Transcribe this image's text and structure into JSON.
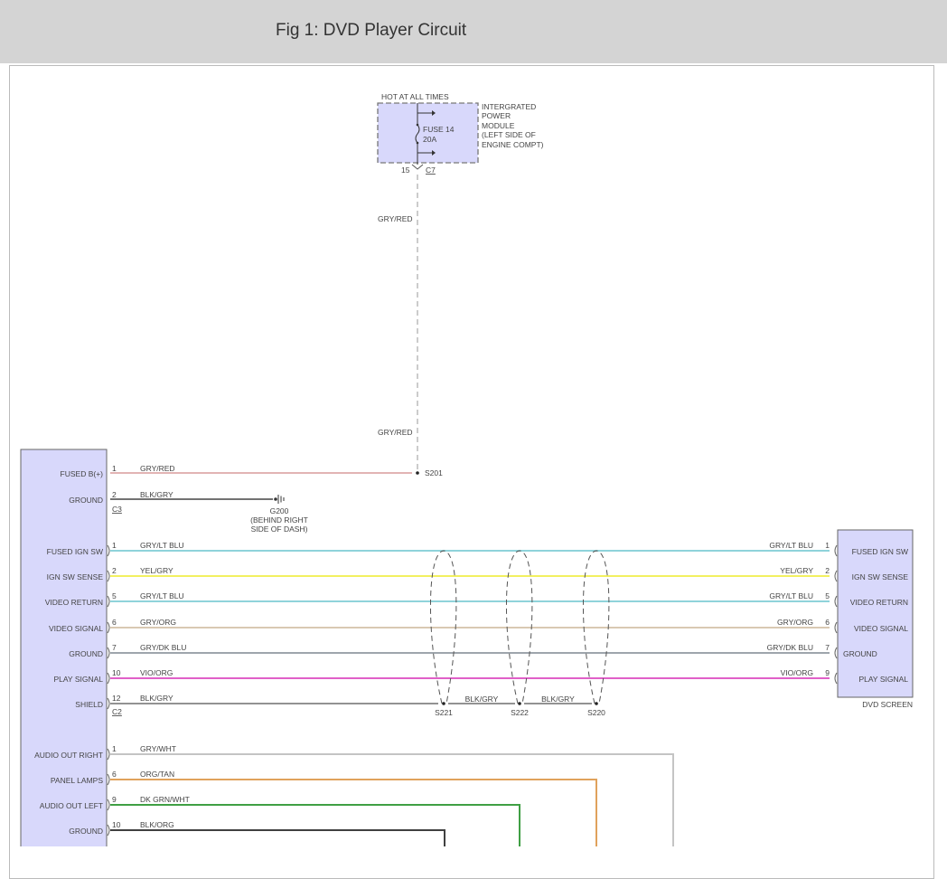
{
  "header": {
    "title": "Fig 1: DVD Player Circuit"
  },
  "power_module": {
    "hot_label": "HOT AT ALL TIMES",
    "name_lines": [
      "INTERGRATED",
      "POWER",
      "MODULE",
      "(LEFT SIDE OF",
      "ENGINE COMPT)"
    ],
    "fuse_name": "FUSE 14",
    "fuse_rating": "20A",
    "pin": "15",
    "connector": "C7"
  },
  "feed_wire": {
    "color_label_top": "GRY/RED",
    "color_label_bottom": "GRY/RED",
    "splice": "S201"
  },
  "ground": {
    "name": "G200",
    "location_lines": [
      "(BEHIND RIGHT",
      "SIDE OF DASH)"
    ]
  },
  "left_module": {
    "c3_connector": "C3",
    "c2_connector": "C2",
    "c3_pins": [
      {
        "label": "FUSED B(+)",
        "pin": "1",
        "wire": "GRY/RED"
      },
      {
        "label": "GROUND",
        "pin": "2",
        "wire": "BLK/GRY"
      }
    ],
    "c2_pins": [
      {
        "label": "FUSED IGN SW",
        "pin": "1",
        "wire": "GRY/LT BLU"
      },
      {
        "label": "IGN SW SENSE",
        "pin": "2",
        "wire": "YEL/GRY"
      },
      {
        "label": "VIDEO RETURN",
        "pin": "5",
        "wire": "GRY/LT BLU"
      },
      {
        "label": "VIDEO SIGNAL",
        "pin": "6",
        "wire": "GRY/ORG"
      },
      {
        "label": "GROUND",
        "pin": "7",
        "wire": "GRY/DK BLU"
      },
      {
        "label": "PLAY SIGNAL",
        "pin": "10",
        "wire": "VIO/ORG"
      },
      {
        "label": "SHIELD",
        "pin": "12",
        "wire": "BLK/GRY"
      }
    ],
    "lower_pins": [
      {
        "label": "AUDIO OUT RIGHT",
        "pin": "1",
        "wire": "GRY/WHT"
      },
      {
        "label": "PANEL LAMPS",
        "pin": "6",
        "wire": "ORG/TAN"
      },
      {
        "label": "AUDIO OUT LEFT",
        "pin": "9",
        "wire": "DK GRN/WHT"
      },
      {
        "label": "GROUND",
        "pin": "10",
        "wire": "BLK/ORG"
      }
    ]
  },
  "dvd_screen": {
    "name": "DVD SCREEN",
    "pins": [
      {
        "label": "FUSED IGN SW",
        "pin": "1",
        "wire": "GRY/LT BLU"
      },
      {
        "label": "IGN SW SENSE",
        "pin": "2",
        "wire": "YEL/GRY"
      },
      {
        "label": "VIDEO RETURN",
        "pin": "5",
        "wire": "GRY/LT BLU"
      },
      {
        "label": "VIDEO SIGNAL",
        "pin": "6",
        "wire": "GRY/ORG"
      },
      {
        "label": "GROUND",
        "pin": "7",
        "wire": "GRY/DK BLU"
      },
      {
        "label": "PLAY SIGNAL",
        "pin": "9",
        "wire": "VIO/ORG"
      }
    ]
  },
  "shield_splices": {
    "splices": [
      "S221",
      "S222",
      "S220"
    ],
    "jumper_wires": [
      "BLK/GRY",
      "BLK/GRY"
    ]
  },
  "colors": {
    "module_fill": "#d8d8fb",
    "gry_red": "#e2b4b4",
    "gry_lt_blu": "#8fd3da",
    "yel_gry": "#f2f060",
    "gry_org": "#d9c9b3",
    "gry_dk_blu": "#7f8790",
    "vio_org": "#e060c8",
    "blk_gry": "#6f6f6f",
    "gry_wht": "#c4c4c4",
    "org_tan": "#e0a25c",
    "dk_grn_wht": "#3f9f44",
    "blk_org": "#404040"
  }
}
